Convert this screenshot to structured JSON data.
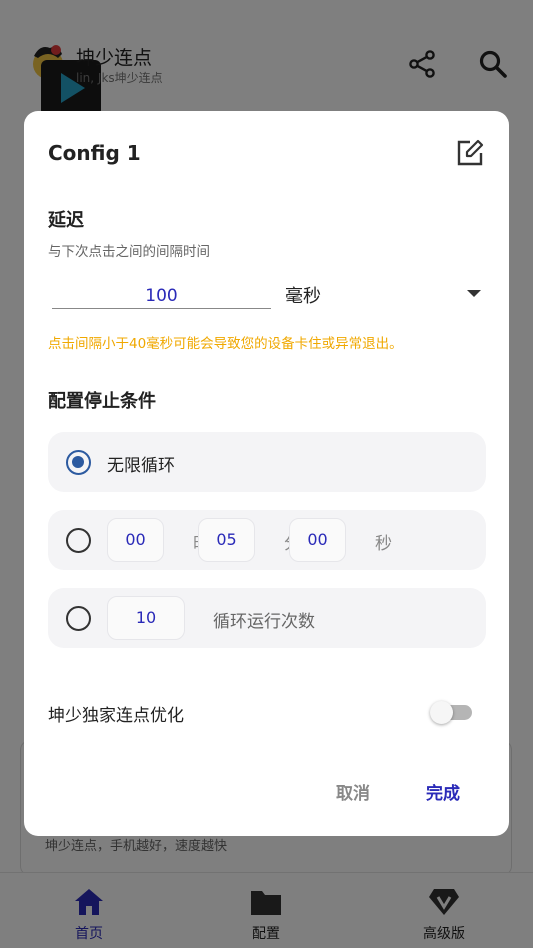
{
  "app": {
    "title": "坤少连点",
    "subtitle": "lin, Jks坤少连点",
    "card_text": "坤少连点，手机越好，速度越快"
  },
  "nav": {
    "home": "首页",
    "config": "配置",
    "pro": "高级版"
  },
  "dialog": {
    "title": "Config 1",
    "delay": {
      "title": "延迟",
      "subtitle": "与下次点击之间的间隔时间",
      "value": "100",
      "unit": "毫秒",
      "warning": "点击间隔小于40毫秒可能会导致您的设备卡住或异常退出。"
    },
    "stop": {
      "title": "配置停止条件",
      "infinite_label": "无限循环",
      "hours": "00",
      "hours_unit": "时",
      "minutes": "05",
      "minutes_unit": "分",
      "seconds": "00",
      "seconds_unit": "秒",
      "count": "10",
      "count_label": "循环运行次数"
    },
    "optimize_label": "坤少独家连点优化",
    "optimize_on": false,
    "cancel": "取消",
    "done": "完成"
  },
  "colors": {
    "accent": "#2a2ab8",
    "radio": "#2c5aa0",
    "warning": "#f0a800"
  }
}
